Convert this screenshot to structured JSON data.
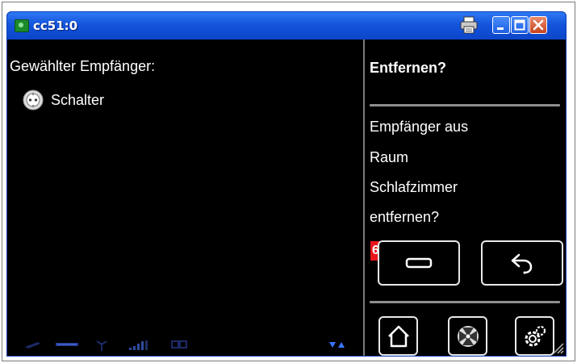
{
  "window": {
    "title": "cc51:0"
  },
  "left_pane": {
    "heading": "Gewählter Empfänger:",
    "receivers": [
      {
        "label": "Schalter",
        "icon": "switch-socket-icon"
      }
    ]
  },
  "right_pane": {
    "title": "Entfernen?",
    "message_lines": [
      "Empfänger aus",
      "Raum",
      "Schlafzimmer",
      "entfernen?"
    ],
    "step_badge": "6"
  },
  "status_icons": [
    "pen-icon",
    "ruler-icon",
    "antenna-icon",
    "signal-bars-icon",
    "link-icon",
    "wifi-arrows-icon"
  ],
  "colors": {
    "titlebar": "#1454db",
    "background": "#000000",
    "badge": "#e9151a",
    "text": "#ffffff"
  }
}
